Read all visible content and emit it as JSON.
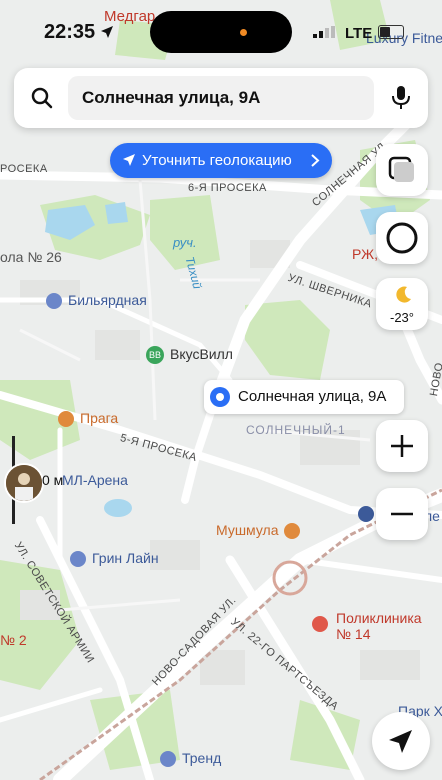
{
  "status": {
    "time": "22:35",
    "network": "LTE",
    "battery_level": 0.45
  },
  "search": {
    "query": "Солнечная улица, 9А"
  },
  "geolocation": {
    "label": "Уточнить геолокацию"
  },
  "weather": {
    "temp": "-23°"
  },
  "marker": {
    "label": "Солнечная улица, 9А"
  },
  "map_labels": {
    "medgar": "Медгар",
    "luxury": "Luxury Fitne",
    "prosek_left": "РОСЕКА",
    "prosek6": "6-Я ПРОСЕКА",
    "solnechnaya_st": "СОЛНЕЧНАЯ УЛ.",
    "shkola": "ола № 26",
    "ruch": "руч.",
    "tikhy": "Тихий",
    "rzhd": "РЖ,",
    "shvernika": "УЛ. ШВЕРНИКА",
    "billiard": "Бильярдная",
    "vkusvill": "ВкусВилл",
    "nova": "НОВО",
    "praga": "Прага",
    "solnechny1": "СОЛНЕЧНЫЙ-1",
    "prosek5": "5-Я ПРОСЕКА",
    "arena": "МЛ-Арена",
    "avatar_distance": "0 м",
    "mushmula": "Мушмула",
    "sovetskoy": "УЛ. СОВЕТСКОЙ АРМИИ",
    "green_line": "Грин Лайн",
    "novosadovaya": "НОВО-САДОВАЯ УЛ.",
    "polyclinic": "Поликлиника № 14",
    "partsezd": "УЛ. 22-ГО ПАРТСЪЕЗДА",
    "school2": "№ 2",
    "trend": "Тренд",
    "park": "Парк Х",
    "right_edge": "ле"
  },
  "colors": {
    "accent": "#2a6ef5",
    "park": "#c9e6b4",
    "water": "#a9d7ee",
    "road": "#ffffff",
    "poi_blue": "#3c5a99",
    "poi_orange": "#e08a3c",
    "poi_red": "#e0584a",
    "poi_green": "#3aa55b"
  },
  "icons": [
    "search-icon",
    "microphone-icon",
    "navigation-arrow-icon",
    "chevron-right-icon",
    "layers-icon",
    "alice-assistant-icon",
    "moon-weather-icon",
    "zoom-in-icon",
    "zoom-out-icon",
    "my-location-icon"
  ]
}
